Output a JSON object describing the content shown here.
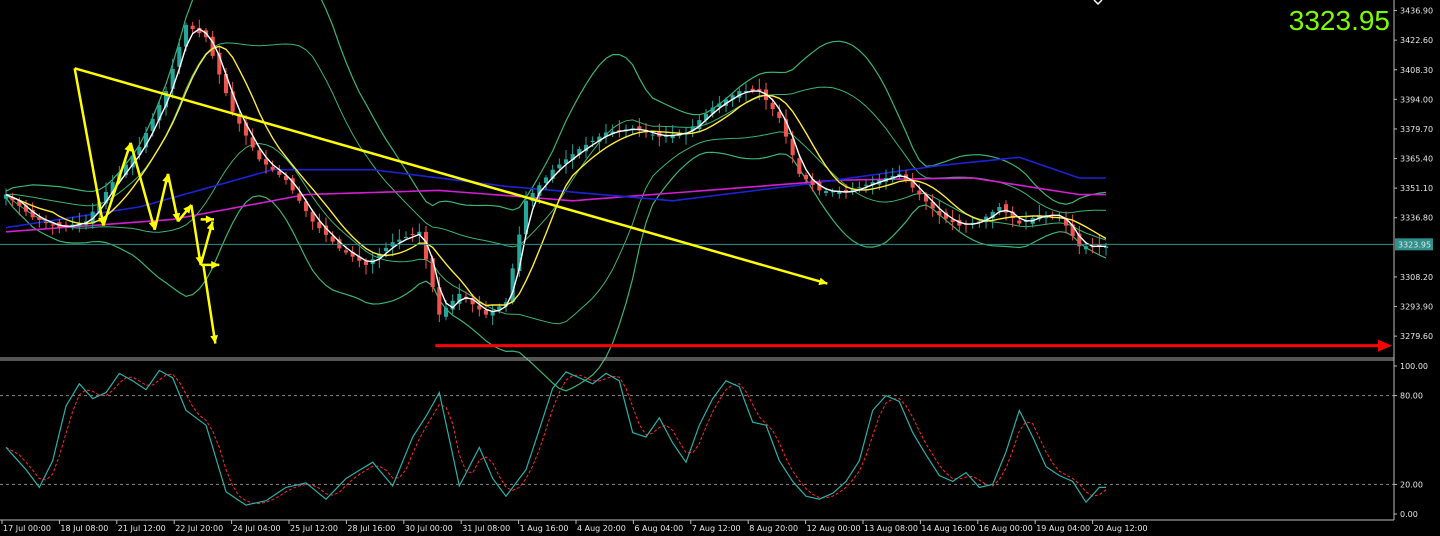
{
  "colors": {
    "background": "#000000",
    "bull": "#26a69a",
    "bear": "#ef5350",
    "bands": "#3cb371",
    "fast_ma": "#ffffff",
    "mid_ma": "#ffeb3b",
    "ma_blue": "#1e22d6",
    "ma_magenta": "#d21fd2",
    "annot": "#ffff00",
    "support": "#ff0000",
    "stoch_main": "#2bb0a8",
    "stoch_signal": "#ff2a2a",
    "price_line": "#2f8f8a",
    "price_text": "#7cfc00"
  },
  "chart_data": {
    "type": "candlestick",
    "price_display": "3323.95",
    "current_price_label": "3323.95",
    "price_axis": {
      "ticks": [
        "3436.90",
        "3422.60",
        "3408.30",
        "3394.00",
        "3379.70",
        "3365.40",
        "3351.10",
        "3336.80",
        "3308.20",
        "3293.90",
        "3279.60"
      ],
      "range": [
        3270,
        3442
      ]
    },
    "time_axis": [
      "17 Jul 00:00",
      "18 Jul 08:00",
      "21 Jul 12:00",
      "22 Jul 20:00",
      "24 Jul 04:00",
      "25 Jul 12:00",
      "28 Jul 16:00",
      "30 Jul 00:00",
      "31 Jul 08:00",
      "1 Aug 16:00",
      "4 Aug 20:00",
      "6 Aug 04:00",
      "7 Aug 12:00",
      "8 Aug 20:00",
      "12 Aug 00:00",
      "13 Aug 08:00",
      "14 Aug 16:00",
      "16 Aug 00:00",
      "19 Aug 04:00",
      "20 Aug 12:00"
    ],
    "close_path": [
      [
        0,
        3348
      ],
      [
        4,
        3337
      ],
      [
        8,
        3332
      ],
      [
        12,
        3335
      ],
      [
        16,
        3354
      ],
      [
        20,
        3371
      ],
      [
        24,
        3398
      ],
      [
        27,
        3430
      ],
      [
        30,
        3424
      ],
      [
        34,
        3388
      ],
      [
        38,
        3365
      ],
      [
        42,
        3355
      ],
      [
        46,
        3335
      ],
      [
        50,
        3322
      ],
      [
        54,
        3314
      ],
      [
        58,
        3325
      ],
      [
        62,
        3330
      ],
      [
        65,
        3290
      ],
      [
        68,
        3300
      ],
      [
        72,
        3290
      ],
      [
        75,
        3296
      ],
      [
        78,
        3345
      ],
      [
        82,
        3360
      ],
      [
        86,
        3370
      ],
      [
        90,
        3378
      ],
      [
        94,
        3380
      ],
      [
        98,
        3376
      ],
      [
        102,
        3378
      ],
      [
        106,
        3390
      ],
      [
        110,
        3398
      ],
      [
        113,
        3398
      ],
      [
        116,
        3385
      ],
      [
        119,
        3358
      ],
      [
        122,
        3350
      ],
      [
        126,
        3349
      ],
      [
        130,
        3354
      ],
      [
        134,
        3358
      ],
      [
        137,
        3348
      ],
      [
        140,
        3338
      ],
      [
        143,
        3333
      ],
      [
        146,
        3335
      ],
      [
        149,
        3342
      ],
      [
        152,
        3334
      ],
      [
        155,
        3338
      ],
      [
        158,
        3338
      ],
      [
        161,
        3323
      ]
    ],
    "support_level": 3275,
    "stochastic": {
      "levels": [
        20,
        80
      ],
      "ticks": [
        "100.00",
        "80.00",
        "20.00",
        "0.00"
      ],
      "k_path": [
        [
          0,
          45
        ],
        [
          3,
          30
        ],
        [
          5,
          18
        ],
        [
          7,
          36
        ],
        [
          9,
          73
        ],
        [
          11,
          88
        ],
        [
          13,
          78
        ],
        [
          15,
          82
        ],
        [
          17,
          95
        ],
        [
          19,
          90
        ],
        [
          21,
          84
        ],
        [
          23,
          97
        ],
        [
          25,
          92
        ],
        [
          27,
          70
        ],
        [
          30,
          60
        ],
        [
          33,
          15
        ],
        [
          36,
          6
        ],
        [
          39,
          9
        ],
        [
          42,
          18
        ],
        [
          45,
          21
        ],
        [
          48,
          10
        ],
        [
          51,
          24
        ],
        [
          55,
          35
        ],
        [
          58,
          19
        ],
        [
          61,
          52
        ],
        [
          63,
          66
        ],
        [
          65,
          82
        ],
        [
          68,
          19
        ],
        [
          71,
          45
        ],
        [
          73,
          24
        ],
        [
          75,
          12
        ],
        [
          78,
          30
        ],
        [
          80,
          57
        ],
        [
          82,
          85
        ],
        [
          84,
          96
        ],
        [
          86,
          92
        ],
        [
          88,
          88
        ],
        [
          90,
          95
        ],
        [
          92,
          90
        ],
        [
          94,
          55
        ],
        [
          96,
          52
        ],
        [
          98,
          65
        ],
        [
          100,
          48
        ],
        [
          102,
          35
        ],
        [
          104,
          60
        ],
        [
          106,
          78
        ],
        [
          108,
          90
        ],
        [
          110,
          86
        ],
        [
          112,
          62
        ],
        [
          114,
          60
        ],
        [
          116,
          36
        ],
        [
          118,
          22
        ],
        [
          120,
          12
        ],
        [
          122,
          10
        ],
        [
          124,
          14
        ],
        [
          126,
          22
        ],
        [
          128,
          36
        ],
        [
          130,
          70
        ],
        [
          132,
          80
        ],
        [
          134,
          76
        ],
        [
          136,
          55
        ],
        [
          138,
          40
        ],
        [
          140,
          26
        ],
        [
          142,
          22
        ],
        [
          144,
          28
        ],
        [
          146,
          18
        ],
        [
          148,
          20
        ],
        [
          150,
          42
        ],
        [
          152,
          70
        ],
        [
          154,
          52
        ],
        [
          156,
          32
        ],
        [
          158,
          26
        ],
        [
          160,
          22
        ],
        [
          162,
          8
        ],
        [
          164,
          18
        ]
      ]
    },
    "bollinger_width": 32,
    "ma_blue_path": [
      [
        0,
        3332
      ],
      [
        20,
        3342
      ],
      [
        40,
        3360
      ],
      [
        55,
        3360
      ],
      [
        75,
        3352
      ],
      [
        100,
        3345
      ],
      [
        120,
        3353
      ],
      [
        140,
        3362
      ],
      [
        152,
        3366
      ],
      [
        161,
        3356
      ]
    ],
    "ma_magenta_path": [
      [
        0,
        3330
      ],
      [
        25,
        3336
      ],
      [
        45,
        3348
      ],
      [
        65,
        3350
      ],
      [
        85,
        3345
      ],
      [
        105,
        3350
      ],
      [
        125,
        3355
      ],
      [
        145,
        3356
      ],
      [
        161,
        3348
      ]
    ],
    "annotations": {
      "trendline": [
        [
          4103,
          3409
        ],
        [
          5232,
          3305
        ]
      ],
      "zigzag": [
        [
          4103,
          3409
        ],
        [
          4146,
          3333
        ],
        [
          4187,
          3373
        ],
        [
          4223,
          3331
        ],
        [
          4243,
          3358
        ],
        [
          4258,
          3335
        ],
        [
          4278,
          3343
        ],
        [
          4292,
          3314
        ],
        [
          4310,
          3335
        ]
      ],
      "arrows": [
        {
          "from": [
            4292,
            3336
          ],
          "to": [
            4312,
            3336
          ]
        },
        {
          "from": [
            4292,
            3314
          ],
          "to": [
            4320,
            3314
          ]
        },
        {
          "from": [
            4296,
            3314
          ],
          "to": [
            4314,
            3276
          ]
        }
      ]
    }
  }
}
